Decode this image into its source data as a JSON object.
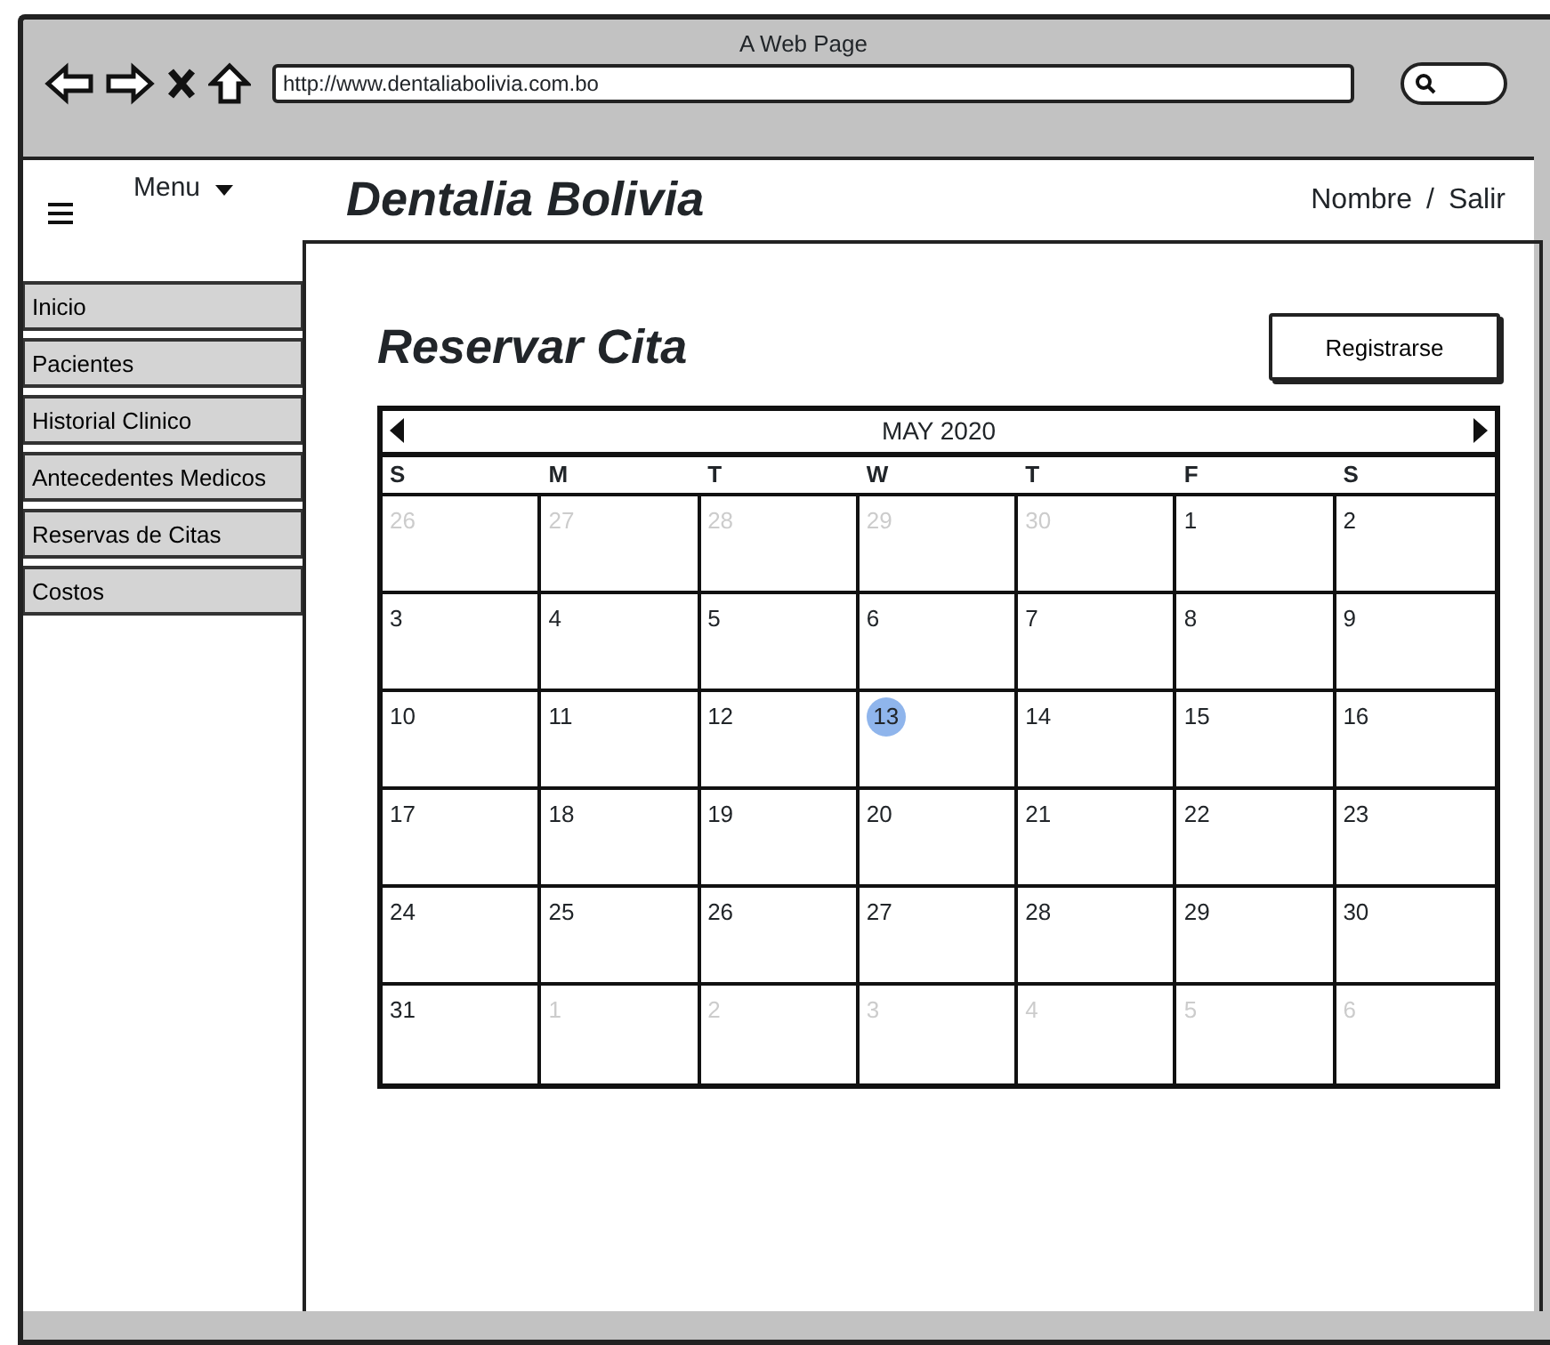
{
  "window": {
    "title": "A Web Page",
    "url": "http://www.dentaliabolivia.com.bo"
  },
  "header": {
    "menu_label": "Menu",
    "brand": "Dentalia Bolivia",
    "user_links": [
      "Nombre",
      "Salir"
    ],
    "separator": "/"
  },
  "sidebar": {
    "items": [
      "Inicio",
      "Pacientes",
      "Historial Clinico",
      "Antecedentes Medicos",
      "Reservas de Citas",
      "Costos"
    ]
  },
  "page": {
    "title": "Reservar Cita",
    "button": "Registrarse"
  },
  "calendar": {
    "month": "MAY 2020",
    "weekdays": [
      "S",
      "M",
      "T",
      "W",
      "T",
      "F",
      "S"
    ],
    "days": [
      {
        "label": "26",
        "muted": true,
        "selected": false
      },
      {
        "label": "27",
        "muted": true,
        "selected": false
      },
      {
        "label": "28",
        "muted": true,
        "selected": false
      },
      {
        "label": "29",
        "muted": true,
        "selected": false
      },
      {
        "label": "30",
        "muted": true,
        "selected": false
      },
      {
        "label": "1",
        "muted": false,
        "selected": false
      },
      {
        "label": "2",
        "muted": false,
        "selected": false
      },
      {
        "label": "3",
        "muted": false,
        "selected": false
      },
      {
        "label": "4",
        "muted": false,
        "selected": false
      },
      {
        "label": "5",
        "muted": false,
        "selected": false
      },
      {
        "label": "6",
        "muted": false,
        "selected": false
      },
      {
        "label": "7",
        "muted": false,
        "selected": false
      },
      {
        "label": "8",
        "muted": false,
        "selected": false
      },
      {
        "label": "9",
        "muted": false,
        "selected": false
      },
      {
        "label": "10",
        "muted": false,
        "selected": false
      },
      {
        "label": "11",
        "muted": false,
        "selected": false
      },
      {
        "label": "12",
        "muted": false,
        "selected": false
      },
      {
        "label": "13",
        "muted": false,
        "selected": true
      },
      {
        "label": "14",
        "muted": false,
        "selected": false
      },
      {
        "label": "15",
        "muted": false,
        "selected": false
      },
      {
        "label": "16",
        "muted": false,
        "selected": false
      },
      {
        "label": "17",
        "muted": false,
        "selected": false
      },
      {
        "label": "18",
        "muted": false,
        "selected": false
      },
      {
        "label": "19",
        "muted": false,
        "selected": false
      },
      {
        "label": "20",
        "muted": false,
        "selected": false
      },
      {
        "label": "21",
        "muted": false,
        "selected": false
      },
      {
        "label": "22",
        "muted": false,
        "selected": false
      },
      {
        "label": "23",
        "muted": false,
        "selected": false
      },
      {
        "label": "24",
        "muted": false,
        "selected": false
      },
      {
        "label": "25",
        "muted": false,
        "selected": false
      },
      {
        "label": "26",
        "muted": false,
        "selected": false
      },
      {
        "label": "27",
        "muted": false,
        "selected": false
      },
      {
        "label": "28",
        "muted": false,
        "selected": false
      },
      {
        "label": "29",
        "muted": false,
        "selected": false
      },
      {
        "label": "30",
        "muted": false,
        "selected": false
      },
      {
        "label": "31",
        "muted": false,
        "selected": false
      },
      {
        "label": "1",
        "muted": true,
        "selected": false
      },
      {
        "label": "2",
        "muted": true,
        "selected": false
      },
      {
        "label": "3",
        "muted": true,
        "selected": false
      },
      {
        "label": "4",
        "muted": true,
        "selected": false
      },
      {
        "label": "5",
        "muted": true,
        "selected": false
      },
      {
        "label": "6",
        "muted": true,
        "selected": false
      }
    ]
  }
}
